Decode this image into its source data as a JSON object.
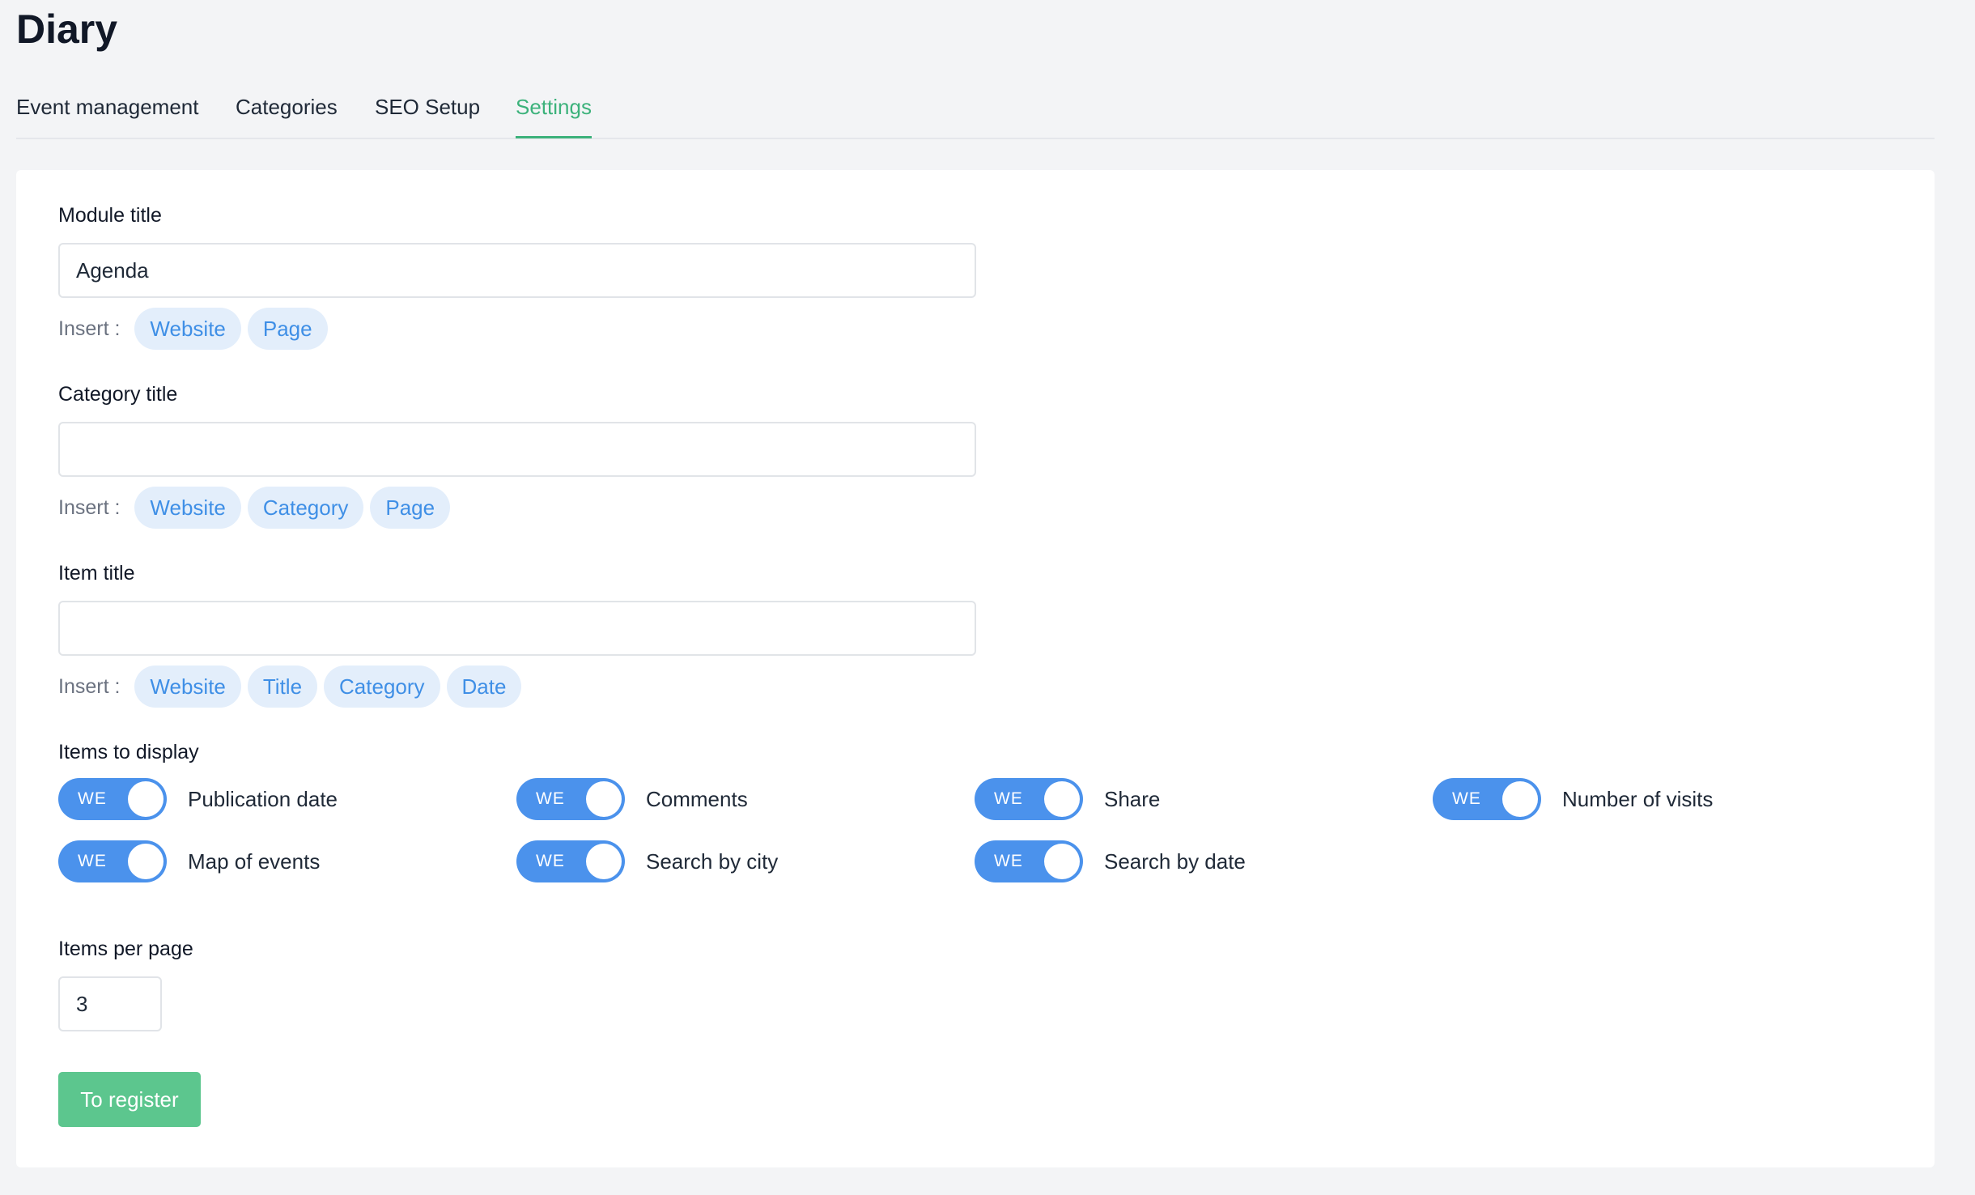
{
  "page": {
    "title": "Diary"
  },
  "tabs": [
    {
      "label": "Event management"
    },
    {
      "label": "Categories"
    },
    {
      "label": "SEO Setup"
    },
    {
      "label": "Settings",
      "active": true
    }
  ],
  "form": {
    "module_title": {
      "label": "Module title",
      "value": "Agenda",
      "insert_label": "Insert :",
      "chips": [
        "Website",
        "Page"
      ]
    },
    "category_title": {
      "label": "Category title",
      "value": "",
      "insert_label": "Insert :",
      "chips": [
        "Website",
        "Category",
        "Page"
      ]
    },
    "item_title": {
      "label": "Item title",
      "value": "",
      "insert_label": "Insert :",
      "chips": [
        "Website",
        "Title",
        "Category",
        "Date"
      ]
    },
    "items_to_display": {
      "label": "Items to display",
      "toggles": [
        {
          "label": "Publication date",
          "state_text": "WE",
          "on": true
        },
        {
          "label": "Comments",
          "state_text": "WE",
          "on": true
        },
        {
          "label": "Share",
          "state_text": "WE",
          "on": true
        },
        {
          "label": "Number of visits",
          "state_text": "WE",
          "on": true
        },
        {
          "label": "Map of events",
          "state_text": "WE",
          "on": true
        },
        {
          "label": "Search by city",
          "state_text": "WE",
          "on": true
        },
        {
          "label": "Search by date",
          "state_text": "WE",
          "on": true
        }
      ]
    },
    "items_per_page": {
      "label": "Items per page",
      "value": "3"
    },
    "submit_label": "To register"
  },
  "colors": {
    "accent_green": "#3cb27b",
    "toggle_blue": "#4b92ec",
    "chip_bg": "#e3eefb",
    "chip_text": "#3f8fe6",
    "button_green": "#5cc68e"
  }
}
